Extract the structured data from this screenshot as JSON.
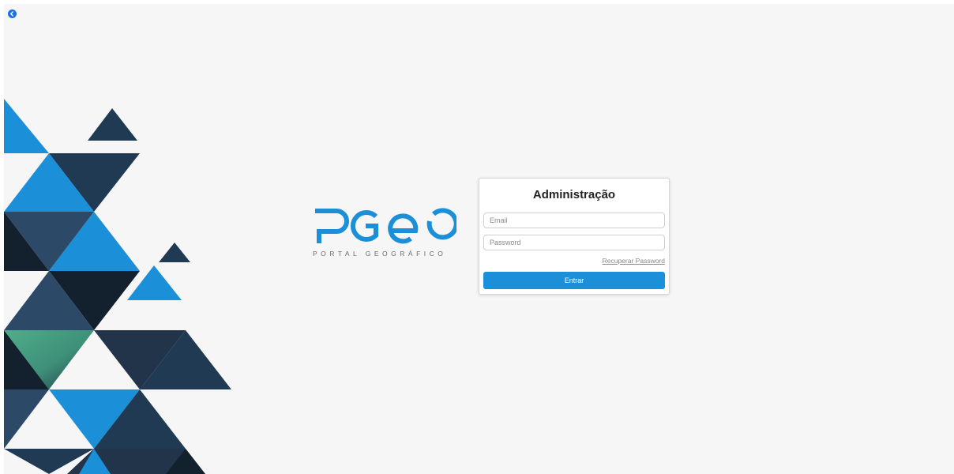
{
  "nav": {
    "back_icon": "arrow-left-circle-icon"
  },
  "brand": {
    "logo_text": "PGEO",
    "subtitle": "PORTAL GEOGRÁFICO"
  },
  "login": {
    "title": "Administração",
    "email_placeholder": "Email",
    "password_placeholder": "Password",
    "recover_label": "Recuperar Password",
    "submit_label": "Entrar"
  },
  "colors": {
    "primary": "#1b8fd8",
    "navy": "#203a53",
    "dark": "#13202e",
    "green": "#4fae8a",
    "background": "#f6f6f6"
  }
}
